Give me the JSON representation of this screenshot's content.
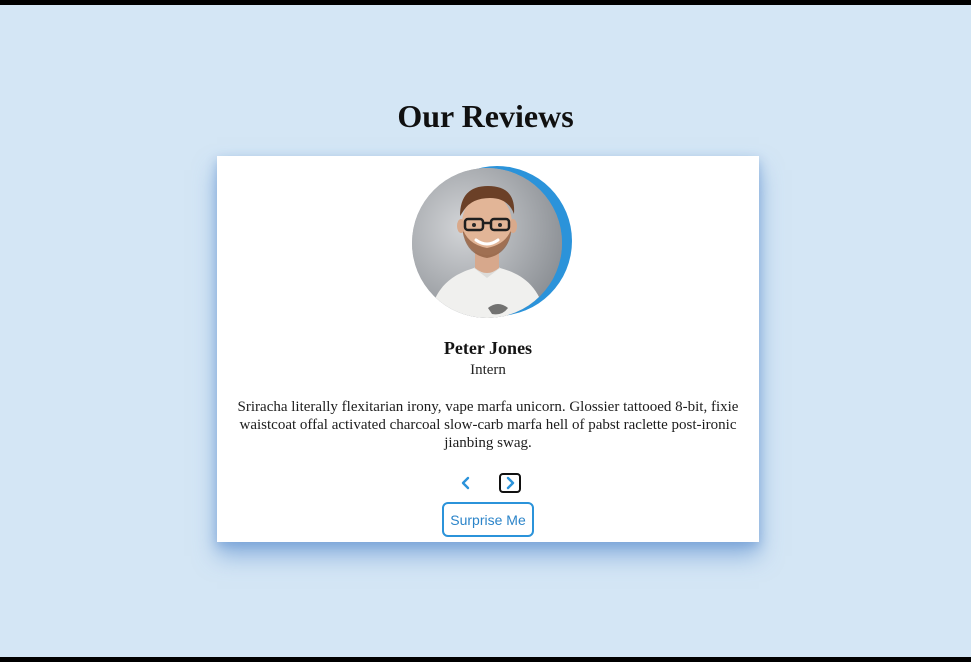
{
  "page": {
    "title": "Our Reviews"
  },
  "review": {
    "name": "Peter Jones",
    "job": "Intern",
    "text": "Sriracha literally flexitarian irony, vape marfa unicorn. Glossier tattooed 8-bit, fixie waistcoat offal activated charcoal slow-carb marfa hell of pabst raclette post-ironic jianbing swag."
  },
  "controls": {
    "prev_icon": "chevron-left-icon",
    "next_icon": "chevron-right-icon",
    "surprise_label": "Surprise Me"
  },
  "colors": {
    "background": "#d4e6f5",
    "accent": "#2b93da",
    "card": "#ffffff",
    "text": "#141414"
  }
}
